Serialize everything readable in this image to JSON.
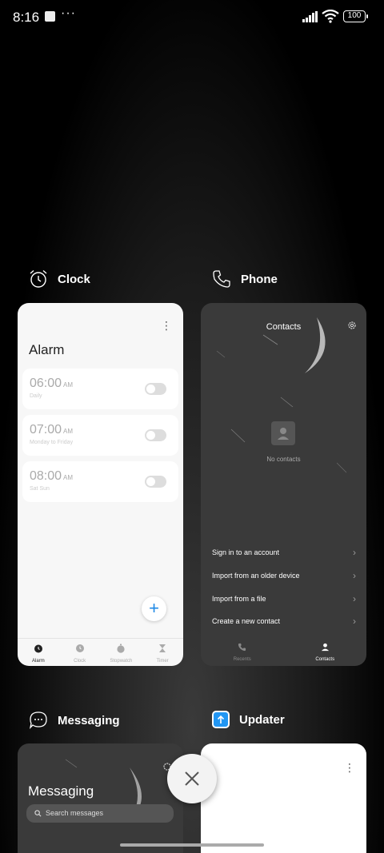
{
  "status_bar": {
    "time": "8:16",
    "more": "···",
    "battery": "100"
  },
  "apps": {
    "clock": {
      "name": "Clock",
      "screen_title": "Alarm",
      "alarms": [
        {
          "time": "06:00",
          "ampm": "AM",
          "repeat": "Daily",
          "enabled": false
        },
        {
          "time": "07:00",
          "ampm": "AM",
          "repeat": "Monday to Friday",
          "enabled": false
        },
        {
          "time": "08:00",
          "ampm": "AM",
          "repeat": "Sat Sun",
          "enabled": false
        }
      ],
      "add_label": "+",
      "nav": [
        "Alarm",
        "Clock",
        "Stopwatch",
        "Timer"
      ]
    },
    "phone": {
      "name": "Phone",
      "screen_title": "Contacts",
      "empty_text": "No contacts",
      "options": [
        "Sign in to an account",
        "Import from an older device",
        "Import from a file",
        "Create a new contact"
      ],
      "nav": [
        "Recents",
        "Contacts"
      ]
    },
    "messaging": {
      "name": "Messaging",
      "screen_title": "Messaging",
      "search_placeholder": "Search messages"
    },
    "updater": {
      "name": "Updater"
    }
  },
  "colors": {
    "accent": "#1e88e5",
    "updater_icon": "#2196f3"
  }
}
